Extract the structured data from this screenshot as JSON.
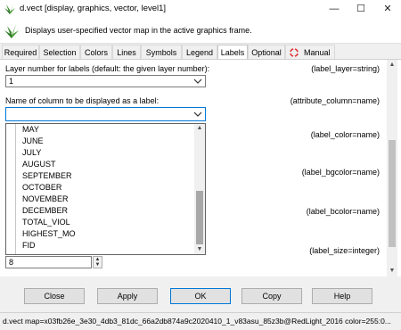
{
  "window": {
    "title": "d.vect [display, graphics, vector, level1]",
    "minimize_label": "—",
    "maximize_label": "☐",
    "close_label": "✕"
  },
  "banner": {
    "description": "Displays user-specified vector map in the active graphics frame."
  },
  "tabs": [
    {
      "label": "Required"
    },
    {
      "label": "Selection"
    },
    {
      "label": "Colors"
    },
    {
      "label": "Lines"
    },
    {
      "label": "Symbols"
    },
    {
      "label": "Legend"
    },
    {
      "label": "Labels"
    },
    {
      "label": "Optional"
    },
    {
      "label": "Manual"
    }
  ],
  "active_tab": "Labels",
  "fields": {
    "label_layer": {
      "label": "Layer number for labels (default: the given layer number):",
      "param": "(label_layer=string)",
      "value": "1"
    },
    "attribute_column": {
      "label": "Name of column to be displayed as a label:",
      "param": "(attribute_column=name)",
      "value": ""
    },
    "label_color": {
      "param": "(label_color=name)"
    },
    "label_bgcolor": {
      "param": "(label_bgcolor=name)"
    },
    "label_bcolor": {
      "param": "(label_bcolor=name)"
    },
    "label_size": {
      "param": "(label_size=integer)",
      "value": "8"
    }
  },
  "dropdown_items": [
    "MAY",
    "JUNE",
    "JULY",
    "AUGUST",
    "SEPTEMBER",
    "OCTOBER",
    "NOVEMBER",
    "DECEMBER",
    "TOTAL_VIOL",
    "HIGHEST_MO",
    "FID"
  ],
  "buttons": {
    "close": "Close",
    "apply": "Apply",
    "ok": "OK",
    "copy": "Copy",
    "help": "Help"
  },
  "status": {
    "command": "d.vect map=x03fb26e_3e30_4db3_81dc_66a2db874a9c2020410_1_v83asu_85z3b@RedLight_2016 color=255:0..."
  },
  "colors": {
    "accent": "#0078d7",
    "grass_green": "#3a8a2e"
  },
  "icons": {
    "app": "grass-leaf-icon",
    "manual_tab": "lifebuoy-icon"
  }
}
